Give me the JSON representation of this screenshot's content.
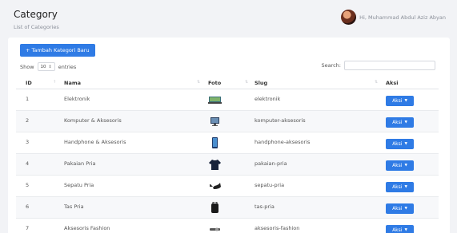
{
  "header": {
    "title": "Category",
    "subtitle": "List of Categories",
    "greeting": "Hi, Muhammad Abdul Aziz Abyan"
  },
  "toolbar": {
    "add_label": "+ Tambah Kategori Baru",
    "show_label": "Show",
    "entries_value": "10",
    "entries_label": "entries",
    "search_label": "Search:"
  },
  "table": {
    "columns": [
      "ID",
      "Nama",
      "Foto",
      "Slug",
      "Aksi"
    ],
    "rows": [
      {
        "id": "1",
        "nama": "Elektronik",
        "slug": "elektronik",
        "aksi": "Aksi",
        "icon": "laptop-icon"
      },
      {
        "id": "2",
        "nama": "Komputer & Aksesoris",
        "slug": "komputer-aksesoris",
        "aksi": "Aksi",
        "icon": "monitor-icon"
      },
      {
        "id": "3",
        "nama": "Handphone & Aksesoris",
        "slug": "handphone-aksesoris",
        "aksi": "Aksi",
        "icon": "phone-icon"
      },
      {
        "id": "4",
        "nama": "Pakaian Pria",
        "slug": "pakaian-pria",
        "aksi": "Aksi",
        "icon": "tshirt-icon"
      },
      {
        "id": "5",
        "nama": "Sepatu Pria",
        "slug": "sepatu-pria",
        "aksi": "Aksi",
        "icon": "shoe-icon"
      },
      {
        "id": "6",
        "nama": "Tas Pria",
        "slug": "tas-pria",
        "aksi": "Aksi",
        "icon": "bag-icon"
      },
      {
        "id": "7",
        "nama": "Aksesoris Fashion",
        "slug": "aksesoris-fashion",
        "aksi": "Aksi",
        "icon": "accessory-icon"
      }
    ]
  },
  "colors": {
    "primary": "#2f7be5",
    "background": "#f2f3f6"
  }
}
